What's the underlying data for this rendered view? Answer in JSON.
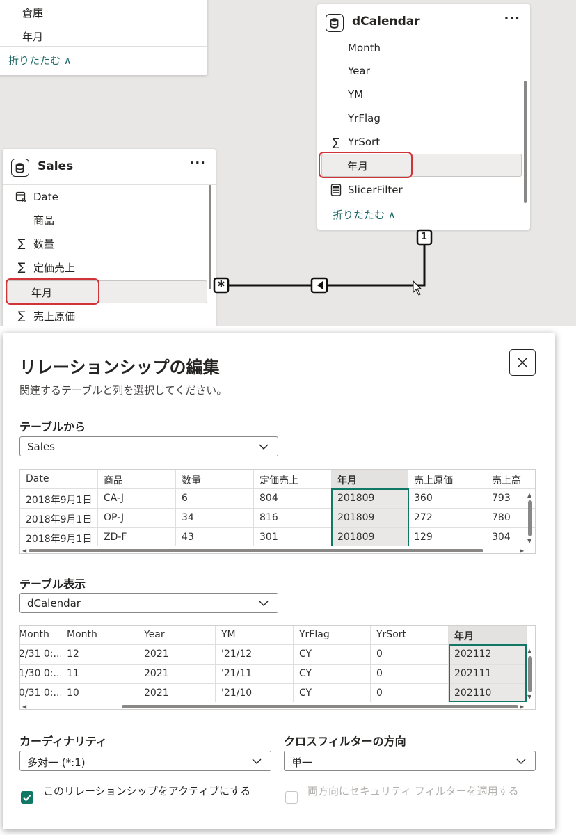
{
  "model": {
    "top_card": {
      "fields": [
        "倉庫",
        "年月"
      ],
      "collapse_label": "折りたたむ ∧"
    },
    "dcalendar": {
      "title": "dCalendar",
      "more": "···",
      "fields": [
        {
          "label": "Month",
          "icon": ""
        },
        {
          "label": "Year",
          "icon": ""
        },
        {
          "label": "YM",
          "icon": ""
        },
        {
          "label": "YrFlag",
          "icon": ""
        },
        {
          "label": "YrSort",
          "icon": "∑"
        },
        {
          "label": "年月",
          "icon": ""
        },
        {
          "label": "SlicerFilter",
          "icon": "calculator-icon"
        }
      ],
      "collapse_label": "折りたたむ ∧"
    },
    "sales": {
      "title": "Sales",
      "more": "···",
      "fields": [
        {
          "label": "Date",
          "icon": "calendar-calc-icon"
        },
        {
          "label": "商品",
          "icon": ""
        },
        {
          "label": "数量",
          "icon": "∑"
        },
        {
          "label": "定価売上",
          "icon": "∑"
        },
        {
          "label": "年月",
          "icon": ""
        },
        {
          "label": "売上原価",
          "icon": "∑"
        }
      ]
    },
    "relationship": {
      "many_marker": "✱",
      "one_marker": "1",
      "direction_marker": "◀"
    }
  },
  "dialog": {
    "title": "リレーションシップの編集",
    "subtitle": "関連するテーブルと列を選択してください。",
    "from_label": "テーブルから",
    "from_table": "Sales",
    "from_grid": {
      "headers": [
        "Date",
        "商品",
        "数量",
        "定価売上",
        "年月",
        "売上原価",
        "売上高"
      ],
      "rows": [
        [
          "2018年9月1日",
          "CA-J",
          "6",
          "804",
          "201809",
          "360",
          "793"
        ],
        [
          "2018年9月1日",
          "OP-J",
          "34",
          "816",
          "201809",
          "272",
          "780"
        ],
        [
          "2018年9月1日",
          "ZD-F",
          "43",
          "301",
          "201809",
          "129",
          "304"
        ]
      ]
    },
    "to_label": "テーブル表示",
    "to_table": "dCalendar",
    "to_grid": {
      "headers": [
        "Month",
        "Month",
        "Year",
        "YM",
        "YrFlag",
        "YrSort",
        "年月"
      ],
      "rows": [
        [
          "2/31 0:...",
          "12",
          "2021",
          "'21/12",
          "CY",
          "0",
          "202112"
        ],
        [
          "1/30 0:...",
          "11",
          "2021",
          "'21/11",
          "CY",
          "0",
          "202111"
        ],
        [
          "0/31 0:...",
          "10",
          "2021",
          "'21/10",
          "CY",
          "0",
          "202110"
        ]
      ]
    },
    "cardinality_label": "カーディナリティ",
    "cardinality_value": "多対一 (*:1)",
    "crossfilter_label": "クロスフィルターの方向",
    "crossfilter_value": "単一",
    "active_checkbox_label": "このリレーションシップをアクティブにする",
    "active_checked": true,
    "security_checkbox_label": "両方向にセキュリティ フィルターを適用する",
    "security_checked": false
  },
  "colors": {
    "accent_teal": "#117865",
    "highlight_red": "#d13438",
    "link_teal": "#1d6a67"
  }
}
